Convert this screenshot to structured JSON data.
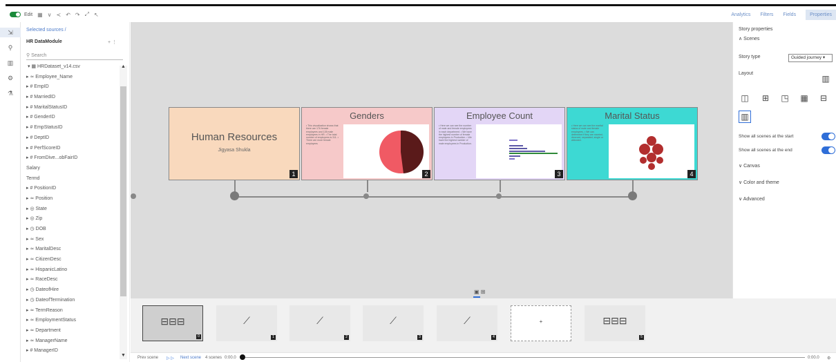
{
  "toolbar": {
    "edit_label": "Edit",
    "right_links": [
      "Analytics",
      "Filters",
      "Fields",
      "Properties"
    ]
  },
  "sources": {
    "breadcrumb": "Selected sources /",
    "module": "HR DataModule",
    "module_actions": "+ ⋮",
    "search_placeholder": "Search",
    "dataset": "HRDataset_v14.csv",
    "fields": [
      "▸ ≃ Employee_Name",
      "▸ # EmpID",
      "▸ # MarriedID",
      "▸ # MaritalStatusID",
      "▸ # GenderID",
      "▸ # EmpStatusID",
      "▸ # DeptID",
      "▸ # PerfScoreID",
      "▸ # FromDive...obFairID",
      "   Salary",
      "   Termd",
      "▸ # PositionID",
      "▸ ≃ Position",
      "▸ ◎ State",
      "▸ ◎ Zip",
      "▸ ◷ DOB",
      "▸ ≃ Sex",
      "▸ ≃ MaritalDesc",
      "▸ ≃ CitizenDesc",
      "▸ ≃ HispanicLatino",
      "▸ ≃ RaceDesc",
      "▸ ◷ DateofHire",
      "▸ ◷ DateofTermination",
      "▸ ≃ TermReason",
      "▸ ≃ EmploymentStatus",
      "▸ ≃ Department",
      "▸ ≃ ManagerName",
      "▸ # ManagerID"
    ]
  },
  "scenes": [
    {
      "title": "Human Resources",
      "subtitle": "Jigyasa Shukla",
      "num": "1",
      "bg": "#f9d9bd"
    },
    {
      "title": "Genders",
      "num": "2",
      "bg": "#f6c9c9",
      "bullets": "• This visualization shows that there are 176 female employees and 135 male employees in HR. • The total number of employees is 311. • There are more female employees"
    },
    {
      "title": "Employee Count",
      "num": "3",
      "bg": "#e3d6f6",
      "bullets": "• Here we can see the number of male and female employees in each department. • We have the highest number of female employees in Production. • We have the highest number of male employees in Production."
    },
    {
      "title": "Marital Status",
      "num": "4",
      "bg": "#3dd9d3",
      "bullets": "• Here we can see the marital status of male and female employees. • We can determine if they are married, divorced, separated, single or widowed."
    }
  ],
  "properties": {
    "header": "Story properties",
    "scenes_section": "Scenes",
    "story_type_label": "Story type",
    "story_type_value": "Guided journey",
    "layout_label": "Layout",
    "show_start": "Show all scenes at the start",
    "show_end": "Show all scenes at the end",
    "sections": [
      "Canvas",
      "Color and theme",
      "Advanced"
    ]
  },
  "strip": {
    "thumbs": [
      {
        "num": "0",
        "icon": "timeline"
      },
      {
        "num": "1",
        "icon": "chart"
      },
      {
        "num": "2",
        "icon": "chart"
      },
      {
        "num": "3",
        "icon": "chart"
      },
      {
        "num": "4",
        "icon": "chart"
      },
      {
        "num": "",
        "icon": "add"
      },
      {
        "num": "5",
        "icon": "timeline"
      }
    ]
  },
  "bottombar": {
    "prev": "Prev scene",
    "next": "Next scene",
    "count": "4 scenes",
    "time_start": "0:00.0",
    "time_end": "0:00.0"
  },
  "colors": {
    "accent": "#2f6ed8",
    "toggle_green": "#1a8a3a",
    "pie_dark": "#5a1a1a",
    "pie_light": "#f05a64",
    "marital_dots": "#b22e2e"
  }
}
